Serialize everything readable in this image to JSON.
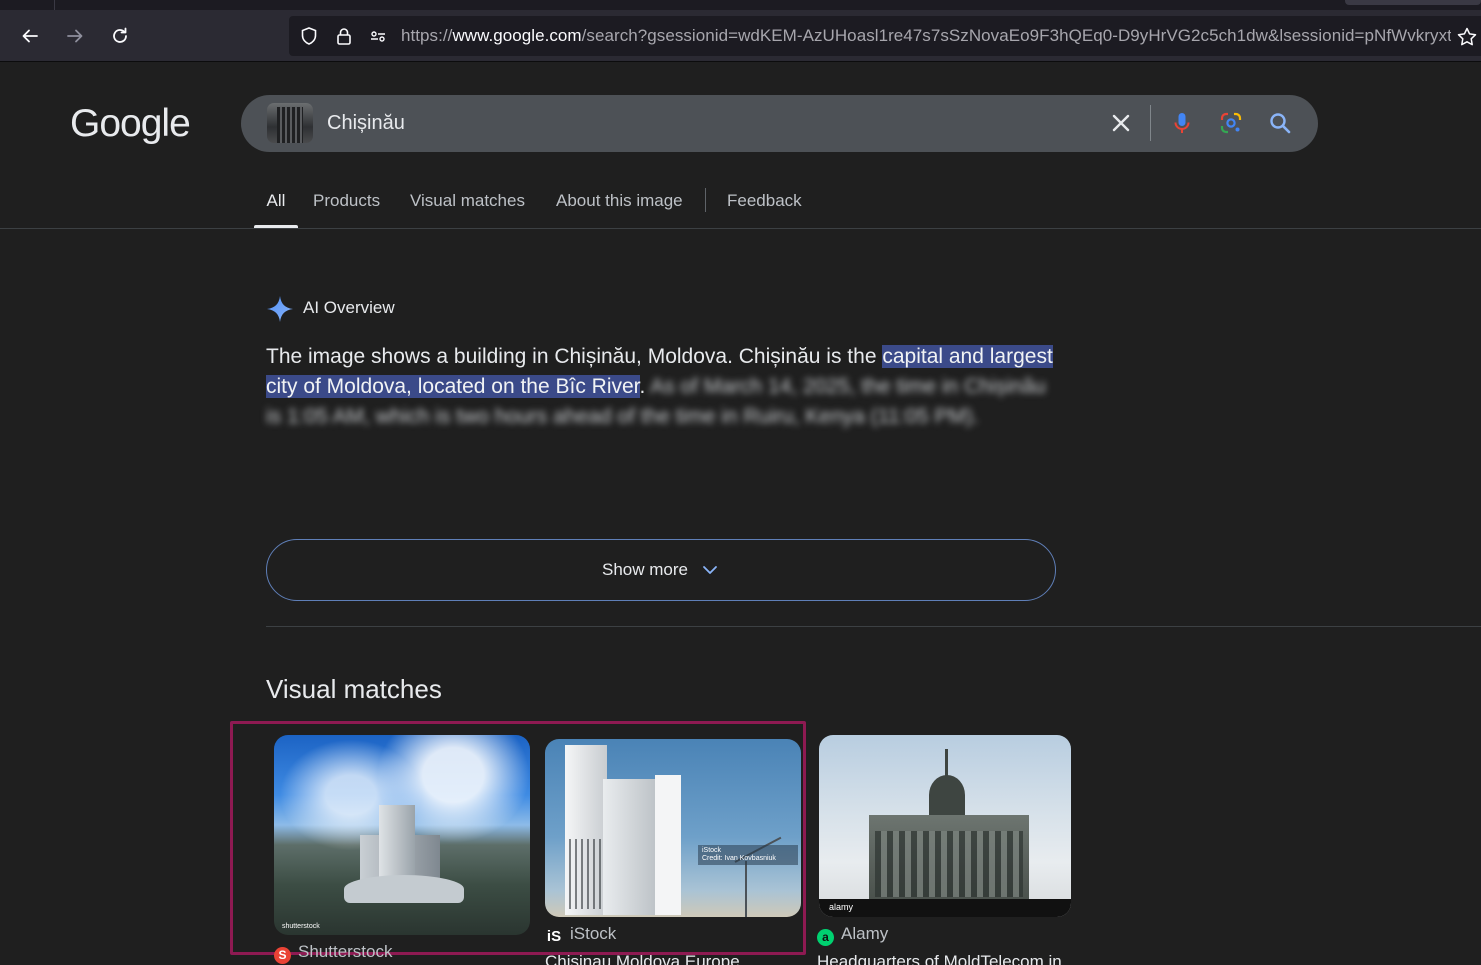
{
  "browser": {
    "back_icon": "arrow-left-icon",
    "forward_icon": "arrow-right-icon",
    "reload_icon": "reload-icon",
    "url_prefix": "https://",
    "url_host": "www.google.com",
    "url_path": "/search?gsessionid=wdKEM-AzUHoasl1re47s7sSzNovaEo9F3hQEq0-D9yHrVG2c5ch1dw&lsessionid=pNfWvkryxt\\"
  },
  "google": {
    "logo": "Google",
    "query": "Chișinău",
    "colors": {
      "mic_blue": "#4285f4",
      "mic_red": "#ea4335",
      "search_icon": "#8ab4f8"
    }
  },
  "tabs": [
    {
      "label": "All",
      "active": true
    },
    {
      "label": "Products"
    },
    {
      "label": "Visual matches"
    },
    {
      "label": "About this image"
    },
    {
      "label": "Feedback"
    }
  ],
  "ai_overview": {
    "label": "AI Overview",
    "text_plain": "The image shows a building in Chișinău, Moldova. Chișinău is the ",
    "text_highlight": "capital and largest city of Moldova, located on the Bîc River",
    "text_after": ".",
    "text_blurred": "As of March 14, 2025, the time in Chișinău is 1:05 AM, which is two hours ahead of the time in Ruiru, Kenya (11:05 PM).",
    "show_more": "Show more"
  },
  "visual_matches": {
    "title": "Visual matches",
    "items": [
      {
        "source": "Shutterstock",
        "title": "",
        "watermark": "shutterstock",
        "favicon_color": "#ea4335"
      },
      {
        "source": "iStock",
        "title": "Chisinau Moldova Europe",
        "tag_line1": "iStock",
        "tag_line2": "Credit: Ivan Kovbasniuk",
        "favicon_color": "#ffffff"
      },
      {
        "source": "Alamy",
        "title": "Headquarters of MoldTelecom in",
        "watermark": "alamy",
        "favicon_color": "#00d170"
      }
    ]
  }
}
